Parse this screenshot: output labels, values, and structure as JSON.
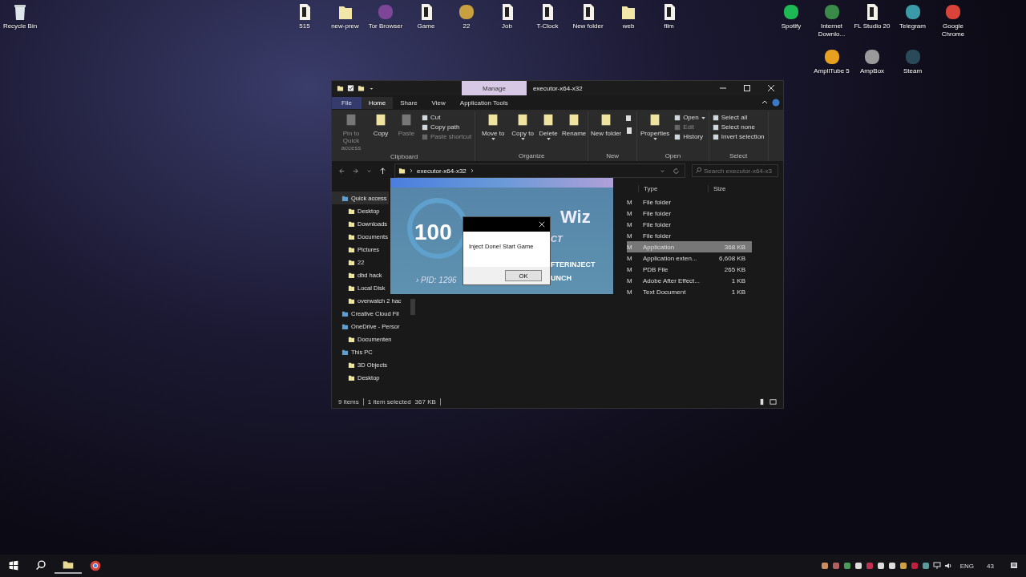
{
  "desktop": {
    "left_icons": [
      {
        "label": "Recycle Bin",
        "kind": "bin"
      }
    ],
    "top_icons": [
      {
        "label": "515",
        "kind": "file"
      },
      {
        "label": "new-prew",
        "kind": "folder"
      },
      {
        "label": "Tor Browser",
        "kind": "app",
        "color": "#7d4698"
      },
      {
        "label": "Game",
        "kind": "file"
      },
      {
        "label": "22",
        "kind": "app",
        "color": "#c8a040"
      },
      {
        "label": "Job",
        "kind": "file"
      },
      {
        "label": "T-Clock",
        "kind": "file"
      },
      {
        "label": "New folder",
        "kind": "file"
      },
      {
        "label": "web",
        "kind": "folder"
      },
      {
        "label": "film",
        "kind": "file"
      }
    ],
    "right_icons": [
      {
        "label": "Spotify",
        "kind": "app",
        "color": "#1db954"
      },
      {
        "label": "Internet Downlo...",
        "kind": "app",
        "color": "#3a8a4a"
      },
      {
        "label": "FL Studio 20",
        "kind": "file"
      },
      {
        "label": "Telegram",
        "kind": "app",
        "color": "#3a9aa8"
      },
      {
        "label": "Google Chrome",
        "kind": "app",
        "color": "#d9443a"
      },
      {
        "label": "AmpliTube 5",
        "kind": "app",
        "color": "#e8a020"
      },
      {
        "label": "AmpBox",
        "kind": "app",
        "color": "#9a9a9a"
      },
      {
        "label": "Steam",
        "kind": "app",
        "color": "#2a4a5a"
      }
    ]
  },
  "explorer": {
    "context_tab": "Manage",
    "title": "executor-x64-x32",
    "ribbon_tabs": [
      {
        "label": "File",
        "selected": false
      },
      {
        "label": "Home",
        "selected": true
      },
      {
        "label": "Share",
        "selected": false
      },
      {
        "label": "View",
        "selected": false
      },
      {
        "label": "Application Tools",
        "selected": false
      }
    ],
    "groups": [
      {
        "label": "Clipboard",
        "large": [
          {
            "label": "Pin to Quick access",
            "disabled": true,
            "dropdown": false
          },
          {
            "label": "Copy",
            "disabled": false,
            "dropdown": false
          },
          {
            "label": "Paste",
            "disabled": true,
            "dropdown": false
          }
        ],
        "small": [
          {
            "label": "Cut",
            "disabled": false,
            "dropdown": false
          },
          {
            "label": "Copy path",
            "disabled": false,
            "dropdown": false
          },
          {
            "label": "Paste shortcut",
            "disabled": true,
            "dropdown": false
          }
        ]
      },
      {
        "label": "Organize",
        "large": [
          {
            "label": "Move to",
            "disabled": false,
            "dropdown": true
          },
          {
            "label": "Copy to",
            "disabled": false,
            "dropdown": true
          },
          {
            "label": "Delete",
            "disabled": false,
            "dropdown": true
          },
          {
            "label": "Rename",
            "disabled": false,
            "dropdown": false
          }
        ]
      },
      {
        "label": "New",
        "large": [
          {
            "label": "New folder",
            "disabled": false,
            "dropdown": false
          }
        ]
      },
      {
        "label": "Open",
        "large": [
          {
            "label": "Properties",
            "disabled": false,
            "dropdown": true
          }
        ],
        "small": [
          {
            "label": "Open",
            "disabled": false,
            "dropdown": true
          },
          {
            "label": "Edit",
            "disabled": true,
            "dropdown": false
          },
          {
            "label": "History",
            "disabled": false,
            "dropdown": false
          }
        ]
      },
      {
        "label": "Select",
        "small": [
          {
            "label": "Select all",
            "disabled": false,
            "dropdown": false
          },
          {
            "label": "Select none",
            "disabled": false,
            "dropdown": false
          },
          {
            "label": "Invert selection",
            "disabled": false,
            "dropdown": false
          }
        ]
      }
    ],
    "address": "executor-x64-x32",
    "search": {
      "placeholder": "Search executor-x64-x3"
    },
    "sidebar": [
      {
        "label": "Quick access",
        "selected": true,
        "children": [
          {
            "label": "Desktop",
            "selected": false
          },
          {
            "label": "Downloads",
            "selected": false
          },
          {
            "label": "Documents",
            "selected": false
          },
          {
            "label": "Pictures",
            "selected": false
          },
          {
            "label": "22",
            "selected": false
          },
          {
            "label": "dbd hack",
            "selected": false
          },
          {
            "label": "Local Disk",
            "selected": false
          },
          {
            "label": "overwatch 2 hac",
            "selected": false
          }
        ]
      },
      {
        "label": "Creative Cloud Fil",
        "selected": false
      },
      {
        "label": "OneDrive - Persor",
        "selected": false,
        "children": [
          {
            "label": "Documenten",
            "selected": false
          }
        ]
      },
      {
        "label": "This PC",
        "selected": false,
        "children": [
          {
            "label": "3D Objects",
            "selected": false
          },
          {
            "label": "Desktop",
            "selected": false
          }
        ]
      }
    ],
    "columns": [
      "Type",
      "Size"
    ],
    "rows": [
      {
        "column_1": "M",
        "type": "File folder",
        "size": "",
        "selected": false
      },
      {
        "column_1": "M",
        "type": "File folder",
        "size": "",
        "selected": false
      },
      {
        "column_1": "M",
        "type": "File folder",
        "size": "",
        "selected": false
      },
      {
        "column_1": "M",
        "type": "File folder",
        "size": "",
        "selected": false
      },
      {
        "column_1": "M",
        "type": "Application",
        "size": "368 KB",
        "selected": true
      },
      {
        "column_1": "M",
        "type": "Application exten...",
        "size": "6,608 KB",
        "selected": false
      },
      {
        "column_1": "M",
        "type": "PDB File",
        "size": "265 KB",
        "selected": false
      },
      {
        "column_1": "M",
        "type": "Adobe After Effect...",
        "size": "1 KB",
        "selected": false
      },
      {
        "column_1": "M",
        "type": "Text Document",
        "size": "1 KB",
        "selected": false
      }
    ],
    "status": {
      "count": "9 items",
      "selection": "1 item selected",
      "size": "367 KB"
    }
  },
  "injector": {
    "progress": "100",
    "brand": "Wiz",
    "fragment_1": "CT",
    "fragment_2": "FTERINJECT",
    "fragment_3": "UNCH",
    "pid": "› PID: 1296"
  },
  "message_box": {
    "text": "Inject Done! Start Game",
    "button": "OK"
  },
  "taskbar": {
    "tray": {
      "language": "ENG",
      "time": "43"
    }
  }
}
